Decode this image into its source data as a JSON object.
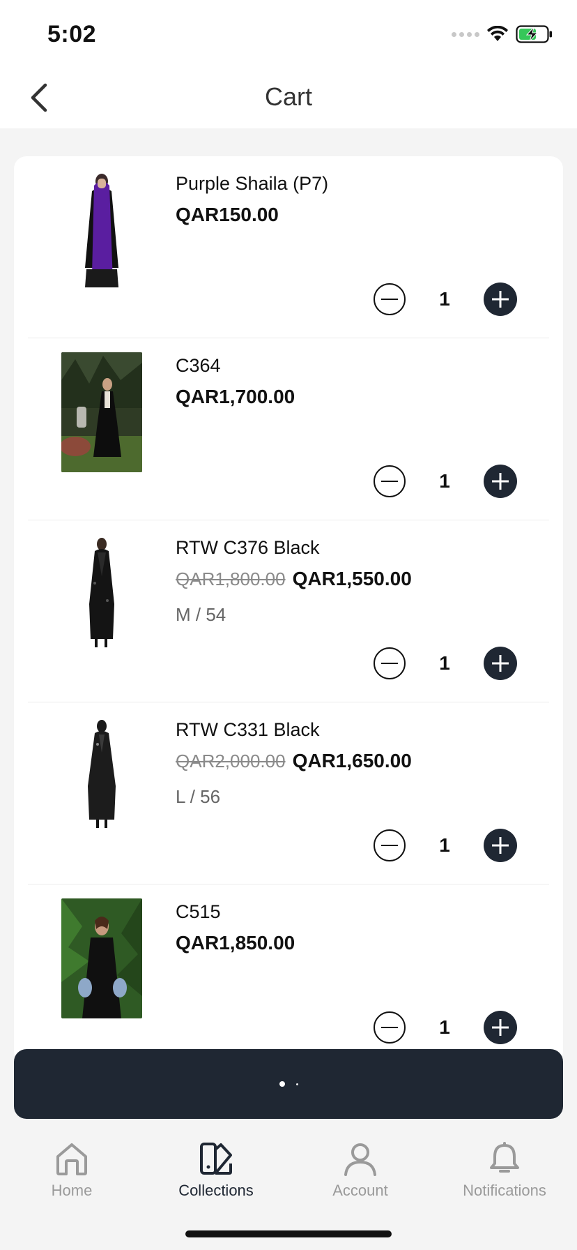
{
  "status_bar": {
    "time": "5:02"
  },
  "header": {
    "title": "Cart"
  },
  "cart": {
    "items": [
      {
        "title": "Purple Shaila (P7)",
        "price_old": "",
        "price": "QAR150.00",
        "variant": "",
        "quantity": "1"
      },
      {
        "title": "C364",
        "price_old": "",
        "price": "QAR1,700.00",
        "variant": "",
        "quantity": "1"
      },
      {
        "title": "RTW C376 Black",
        "price_old": "QAR1,800.00",
        "price": "QAR1,550.00",
        "variant": "M / 54",
        "quantity": "1"
      },
      {
        "title": "RTW C331 Black",
        "price_old": "QAR2,000.00",
        "price": "QAR1,650.00",
        "variant": "L / 56",
        "quantity": "1"
      },
      {
        "title": "C515",
        "price_old": "",
        "price": "QAR1,850.00",
        "variant": "",
        "quantity": "1"
      }
    ]
  },
  "tabs": [
    {
      "label": "Home",
      "icon": "home-icon",
      "active": false
    },
    {
      "label": "Collections",
      "icon": "collections-icon",
      "active": true
    },
    {
      "label": "Account",
      "icon": "account-icon",
      "active": false
    },
    {
      "label": "Notifications",
      "icon": "bell-icon",
      "active": false
    }
  ],
  "colors": {
    "accent": "#1f2733",
    "inactive": "#9a9a9a",
    "background": "#f4f4f4",
    "card": "#ffffff"
  }
}
